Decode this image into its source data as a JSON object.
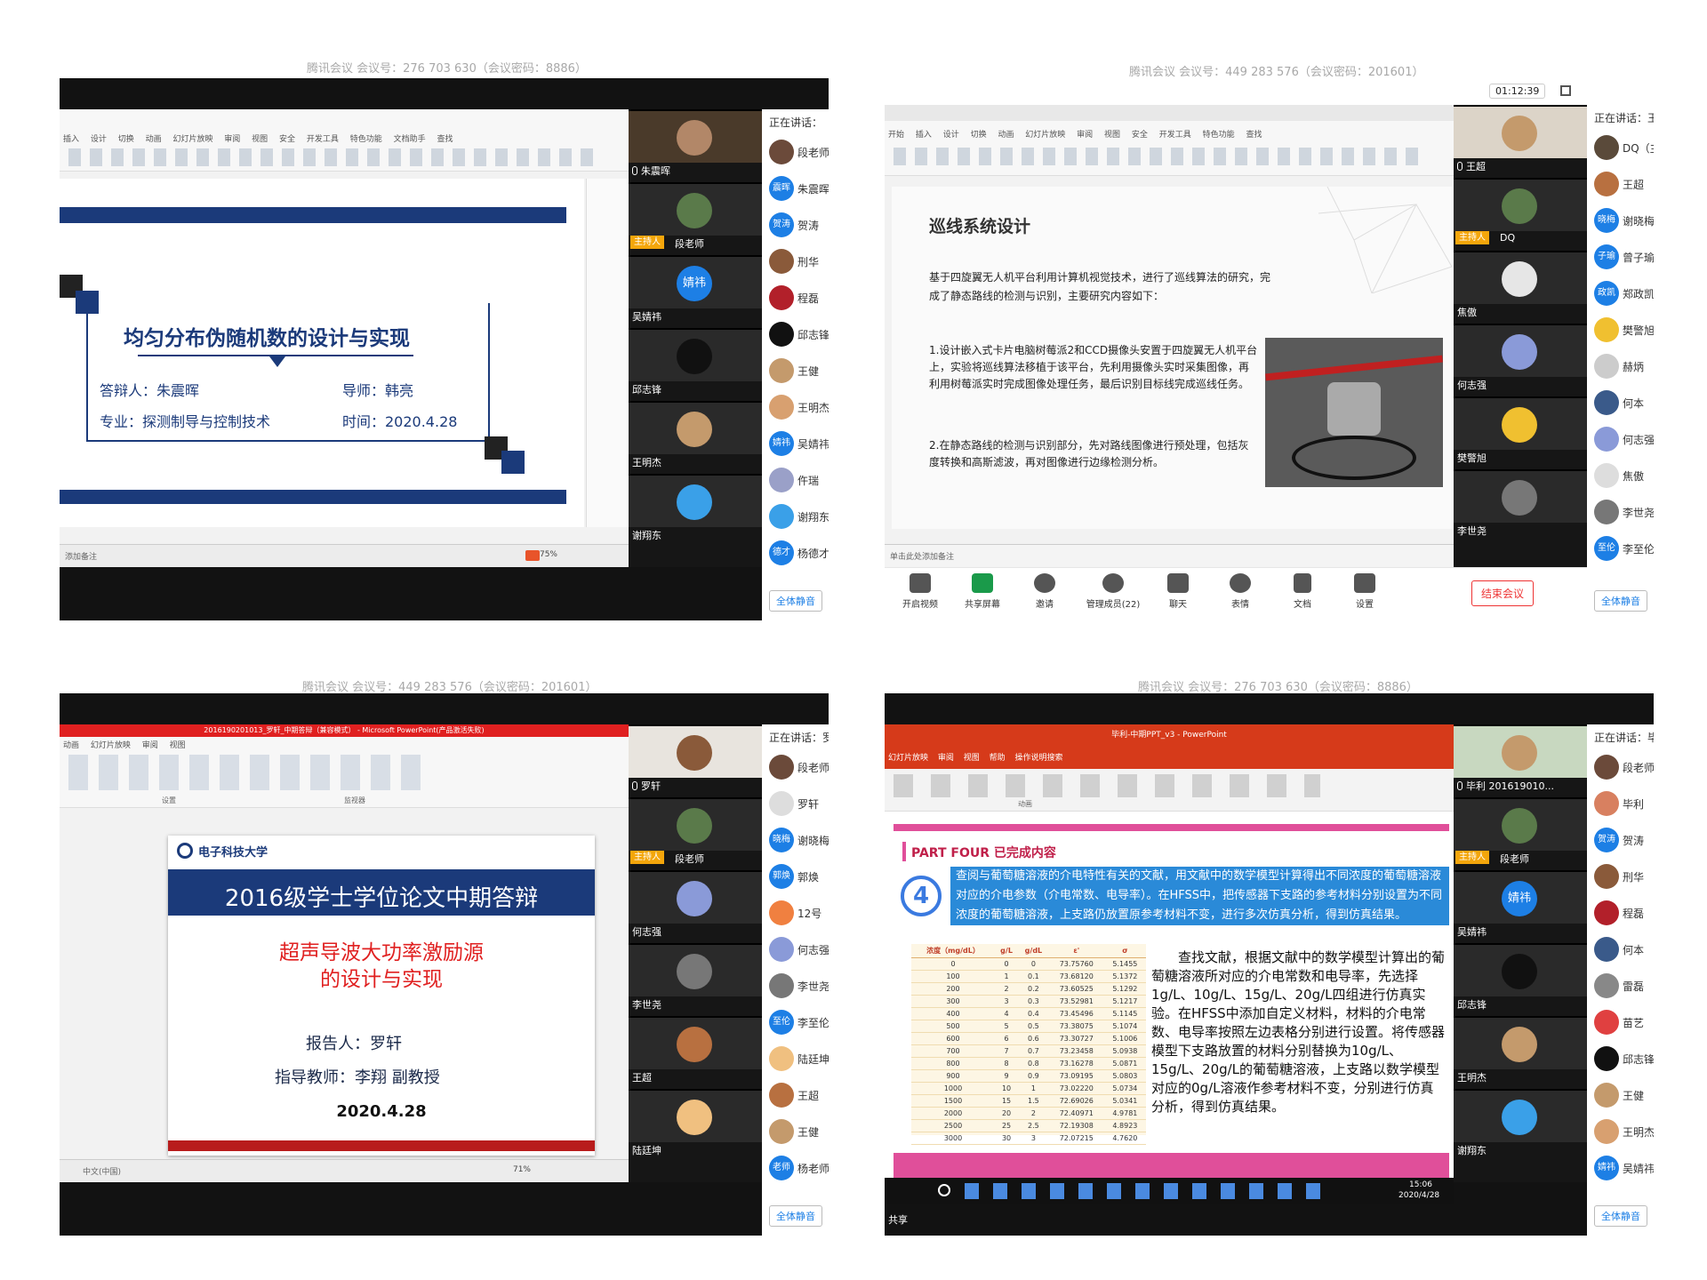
{
  "panels": [
    {
      "meeting_caption": "腾讯会议 会议号：276 703 630（会议密码：8886）",
      "ribbon_tabs": "插入 设计 切换 动画 幻灯片放映 审阅 视图 安全 开发工具 特色功能 文档助手 查找",
      "slide_title": "均匀分布伪随机数的设计与实现",
      "slide_respondent": "答辩人：朱震晖",
      "slide_advisor": "导师：韩亮",
      "slide_major": "专业：探测制导与控制技术",
      "slide_date": "时间：2020.4.28",
      "status_left": "添加备注",
      "zoom": "75%",
      "tiles": [
        {
          "name": "朱震晖",
          "host": false
        },
        {
          "name": "段老师",
          "host": true
        },
        {
          "name": "吴婧祎",
          "host": false,
          "badge": "婧祎"
        },
        {
          "name": "邱志锋",
          "host": false
        },
        {
          "name": "王明杰",
          "host": false
        },
        {
          "name": "谢翔东",
          "host": false
        }
      ],
      "speaking_label": "正在讲话：",
      "participants": [
        {
          "badge": "",
          "name": "段老师"
        },
        {
          "badge": "震晖",
          "name": "朱震晖"
        },
        {
          "badge": "贺涛",
          "name": "贺涛"
        },
        {
          "badge": "",
          "name": "刑华"
        },
        {
          "badge": "",
          "name": "程磊"
        },
        {
          "badge": "",
          "name": "邱志锋"
        },
        {
          "badge": "",
          "name": "王健"
        },
        {
          "badge": "",
          "name": "王明杰"
        },
        {
          "badge": "婧祎",
          "name": "吴婧祎"
        },
        {
          "badge": "",
          "name": "仵瑞"
        },
        {
          "badge": "",
          "name": "谢翔东"
        },
        {
          "badge": "德才",
          "name": "杨德才"
        }
      ],
      "mute_all": "全体静音"
    },
    {
      "meeting_caption": "腾讯会议 会议号：449 283 576（会议密码：201601）",
      "timer": "01:12:39",
      "ribbon_tabs": "开始 插入 设计 切换 动画 幻灯片放映 审阅 视图 安全 开发工具 特色功能 查找",
      "slide_title": "巡线系统设计",
      "slide_intro": "基于四旋翼无人机平台利用计算机视觉技术，进行了巡线算法的研究，完成了静态路线的检测与识别，主要研究内容如下：",
      "slide_point1": "1.设计嵌入式卡片电脑树莓派2和CCD摄像头安置于四旋翼无人机平台上，实验将巡线算法移植于该平台，先利用摄像头实时采集图像，再利用树莓派实时完成图像处理任务，最后识别目标线完成巡线任务。",
      "slide_point2": "2.在静态路线的检测与识别部分，先对路线图像进行预处理，包括灰度转换和高斯滤波，再对图像进行边缘检测分析。",
      "status_left": "单击此处添加备注",
      "tiles": [
        {
          "name": "王超",
          "host": false
        },
        {
          "name": "DQ",
          "host": true
        },
        {
          "name": "焦傲",
          "host": false
        },
        {
          "name": "何志强",
          "host": false
        },
        {
          "name": "樊警旭",
          "host": false
        },
        {
          "name": "李世尧",
          "host": false
        }
      ],
      "speaking_label": "正在讲话：王",
      "participants": [
        {
          "badge": "",
          "name": "DQ（主"
        },
        {
          "badge": "",
          "name": "王超"
        },
        {
          "badge": "晓梅",
          "name": "谢晓梅"
        },
        {
          "badge": "子瑜",
          "name": "曾子瑜"
        },
        {
          "badge": "政凯",
          "name": "郑政凯"
        },
        {
          "badge": "",
          "name": "樊警旭"
        },
        {
          "badge": "",
          "name": "赫炳"
        },
        {
          "badge": "",
          "name": "何本"
        },
        {
          "badge": "",
          "name": "何志强"
        },
        {
          "badge": "",
          "name": "焦傲"
        },
        {
          "badge": "",
          "name": "李世尧"
        },
        {
          "badge": "至伦",
          "name": "李至伦"
        }
      ],
      "mute_all": "全体静音",
      "toolbar": [
        {
          "label": "开启视频"
        },
        {
          "label": "共享屏幕"
        },
        {
          "label": "邀请"
        },
        {
          "label": "管理成员(22)"
        },
        {
          "label": "聊天"
        },
        {
          "label": "表情"
        },
        {
          "label": "文档"
        },
        {
          "label": "设置"
        }
      ],
      "end_meeting": "结束会议"
    },
    {
      "meeting_caption": "腾讯会议 会议号：449 283 576（会议密码：201601）",
      "window_title": "2016190201013_罗轩_中期答辩（兼容模式） - Microsoft PowerPoint(产品激活失败)",
      "ribbon_tabs": "动画 幻灯片放映 审阅 视图",
      "ribbon_group1": "设置",
      "ribbon_group2": "监视器",
      "univ_name": "电子科技大学",
      "slide_header": "2016级学士学位论文中期答辩",
      "slide_title_line1": "超声导波大功率激励源",
      "slide_title_line2": "的设计与实现",
      "reporter": "报告人：罗轩",
      "advisor": "指导教师：李翔 副教授",
      "date": "2020.4.28",
      "status_left": "中文(中国)",
      "zoom": "71%",
      "tiles": [
        {
          "name": "罗轩",
          "host": false
        },
        {
          "name": "段老师",
          "host": true
        },
        {
          "name": "何志强",
          "host": false
        },
        {
          "name": "李世尧",
          "host": false
        },
        {
          "name": "王超",
          "host": false
        },
        {
          "name": "陆廷坤",
          "host": false
        }
      ],
      "speaking_label": "正在讲话：罗",
      "participants": [
        {
          "badge": "",
          "name": "段老师"
        },
        {
          "badge": "",
          "name": "罗轩"
        },
        {
          "badge": "晓梅",
          "name": "谢晓梅"
        },
        {
          "badge": "郭焕",
          "name": "郭焕"
        },
        {
          "badge": "",
          "name": "12号"
        },
        {
          "badge": "",
          "name": "何志强"
        },
        {
          "badge": "",
          "name": "李世尧"
        },
        {
          "badge": "至伦",
          "name": "李至伦"
        },
        {
          "badge": "",
          "name": "陆廷坤"
        },
        {
          "badge": "",
          "name": "王超"
        },
        {
          "badge": "",
          "name": "王健"
        },
        {
          "badge": "老师",
          "name": "杨老师"
        }
      ],
      "mute_all": "全体静音"
    },
    {
      "meeting_caption": "腾讯会议 会议号：276 703 630（会议密码：8886）",
      "window_title": "毕利-中期PPT_v3 - PowerPoint",
      "ribbon_tabs": "幻灯片放映 审阅 视图 帮助 操作说明搜索",
      "ribbon_group": "动画",
      "part_title": "PART FOUR  已完成内容",
      "part_number": "4",
      "highlight_text": "查阅与葡萄糖溶液的介电特性有关的文献，用文献中的数学模型计算得出不同浓度的葡萄糖溶液对应的介电参数（介电常数、电导率）。在HFSS中，把传感器下支路的参考材料分别设置为不同浓度的葡萄糖溶液，上支路仍放置原参考材料不变，进行多次仿真分析，得到仿真结果。",
      "body_text": "查找文献，根据文献中的数学模型计算出的葡萄糖溶液所对应的介电常数和电导率，先选择1g/L、10g/L、15g/L、20g/L四组进行仿真实验。在HFSS中添加自定义材料，材料的介电常数、电导率按照左边表格分别进行设置。将传感器模型下支路放置的材料分别替换为10g/L、15g/L、20g/L的葡萄糖溶液，上支路以数学模型对应的0g/L溶液作参考材料不变，分别进行仿真分析，得到仿真结果。",
      "table_headers": [
        "浓度（mg/dL）",
        "g/L",
        "g/dL",
        "ε'",
        "σ"
      ],
      "table_rows": [
        [
          "0",
          "0",
          "0",
          "73.75760",
          "5.1455"
        ],
        [
          "100",
          "1",
          "0.1",
          "73.68120",
          "5.1372"
        ],
        [
          "200",
          "2",
          "0.2",
          "73.60525",
          "5.1292"
        ],
        [
          "300",
          "3",
          "0.3",
          "73.52981",
          "5.1217"
        ],
        [
          "400",
          "4",
          "0.4",
          "73.45496",
          "5.1145"
        ],
        [
          "500",
          "5",
          "0.5",
          "73.38075",
          "5.1074"
        ],
        [
          "600",
          "6",
          "0.6",
          "73.30727",
          "5.1006"
        ],
        [
          "700",
          "7",
          "0.7",
          "73.23458",
          "5.0938"
        ],
        [
          "800",
          "8",
          "0.8",
          "73.16278",
          "5.0871"
        ],
        [
          "900",
          "9",
          "0.9",
          "73.09195",
          "5.0803"
        ],
        [
          "1000",
          "10",
          "1",
          "73.02220",
          "5.0734"
        ],
        [
          "1500",
          "15",
          "1.5",
          "72.69026",
          "5.0341"
        ],
        [
          "2000",
          "20",
          "2",
          "72.40971",
          "4.9781"
        ],
        [
          "2500",
          "25",
          "2.5",
          "72.19308",
          "4.8923"
        ],
        [
          "3000",
          "30",
          "3",
          "72.07215",
          "4.7620"
        ]
      ],
      "taskbar_time": "15:06",
      "taskbar_date": "2020/4/28",
      "share_label": "共享",
      "tiles": [
        {
          "name": "毕利 201619010...",
          "host": false
        },
        {
          "name": "段老师",
          "host": true
        },
        {
          "name": "吴婧祎",
          "host": false,
          "badge": "婧祎"
        },
        {
          "name": "邱志锋",
          "host": false
        },
        {
          "name": "王明杰",
          "host": false
        },
        {
          "name": "谢翔东",
          "host": false
        }
      ],
      "speaking_label": "正在讲话：毕",
      "participants": [
        {
          "badge": "",
          "name": "段老师"
        },
        {
          "badge": "",
          "name": "毕利"
        },
        {
          "badge": "贺涛",
          "name": "贺涛"
        },
        {
          "badge": "",
          "name": "刑华"
        },
        {
          "badge": "",
          "name": "程磊"
        },
        {
          "badge": "",
          "name": "何本"
        },
        {
          "badge": "",
          "name": "雷磊"
        },
        {
          "badge": "",
          "name": "苗艺"
        },
        {
          "badge": "",
          "name": "邱志锋"
        },
        {
          "badge": "",
          "name": "王健"
        },
        {
          "badge": "",
          "name": "王明杰"
        },
        {
          "badge": "婧祎",
          "name": "吴婧祎"
        }
      ],
      "mute_all": "全体静音"
    }
  ],
  "common": {
    "host_label": "主持人"
  },
  "colors": {
    "accent_blue": "#1d7fe5",
    "slide_navy": "#1b3a7a",
    "ppt_red": "#d63a1a",
    "host_orange": "#f4a60b",
    "pink": "#e04f9a"
  }
}
